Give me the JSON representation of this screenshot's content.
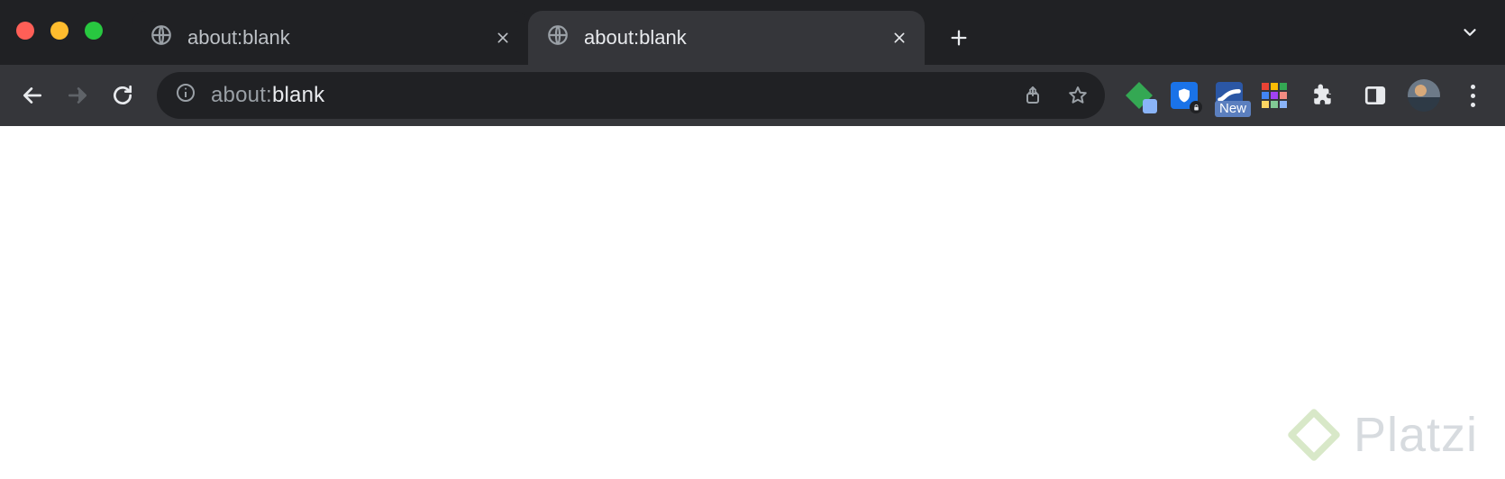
{
  "window": {
    "traffic_lights": {
      "close": "#ff5f57",
      "minimize": "#febc2e",
      "zoom": "#28c840"
    }
  },
  "tabs": [
    {
      "title": "about:blank",
      "favicon": "globe-icon",
      "active": false
    },
    {
      "title": "about:blank",
      "favicon": "globe-icon",
      "active": true
    }
  ],
  "tab_strip": {
    "new_tab_tooltip": "New Tab",
    "overflow_tooltip": "Search tabs"
  },
  "toolbar": {
    "back_tooltip": "Back",
    "forward_tooltip": "Forward",
    "reload_tooltip": "Reload",
    "share_tooltip": "Share",
    "bookmark_tooltip": "Bookmark",
    "extensions_tooltip": "Extensions",
    "side_panel_tooltip": "Side panel",
    "profile_tooltip": "Profile",
    "menu_tooltip": "Customize and control"
  },
  "omnibox": {
    "scheme": "about:",
    "path": "blank",
    "full": "about:blank",
    "site_info_tooltip": "View site information"
  },
  "extensions": [
    {
      "name": "extension-green-shield",
      "color": "#34a853",
      "indicator": true
    },
    {
      "name": "extension-blue-shield",
      "color": "#1a73e8",
      "lock": true
    },
    {
      "name": "extension-stream",
      "color": "#2b57a5",
      "badge": "New"
    },
    {
      "name": "extension-color-grid"
    }
  ],
  "watermark": {
    "text": "Platzi"
  }
}
